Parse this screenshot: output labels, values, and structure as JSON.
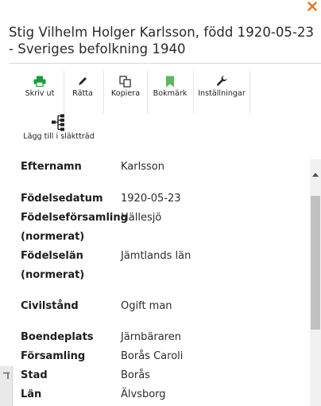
{
  "dialog": {
    "title": "Stig Vilhelm Holger Karlsson, född 1920-05-23 - Sveriges befolkning 1940",
    "close_icon": "close-icon",
    "accent_color": "#e87722"
  },
  "toolbar": {
    "print": {
      "label": "Skriv ut",
      "icon": "printer-icon",
      "color": "#1a9b3c"
    },
    "correct": {
      "label": "Rätta",
      "icon": "pencil-icon"
    },
    "copy": {
      "label": "Kopiera",
      "icon": "copy-icon"
    },
    "bookmark": {
      "label": "Bokmärk",
      "icon": "bookmark-icon",
      "color": "#5cb85c"
    },
    "settings": {
      "label": "Inställningar",
      "icon": "wrench-icon"
    },
    "family_tree": {
      "label": "Lägg till i släktträd",
      "icon": "family-tree-icon"
    }
  },
  "details": {
    "rows": [
      {
        "label": "Efternamn",
        "value": "Karlsson"
      },
      {
        "label": "Födelsedatum",
        "value": "1920-05-23"
      },
      {
        "label": "Födelseförsamling (normerat)",
        "label_line1": "Födelseförsamling",
        "label_line2": "(normerat)",
        "value": "Hällesjö"
      },
      {
        "label": "Födelselän (normerat)",
        "label_line1": "Födelselän",
        "label_line2": "(normerat)",
        "value": "Jämtlands län"
      },
      {
        "label": "Civilstånd",
        "value": "Ogift man"
      },
      {
        "label": "Boendeplats",
        "value": "Järnbäraren"
      },
      {
        "label": "Församling",
        "value": "Borås Caroli"
      },
      {
        "label": "Stad",
        "value": "Borås"
      },
      {
        "label": "Län",
        "value": "Älvsborg"
      }
    ]
  }
}
